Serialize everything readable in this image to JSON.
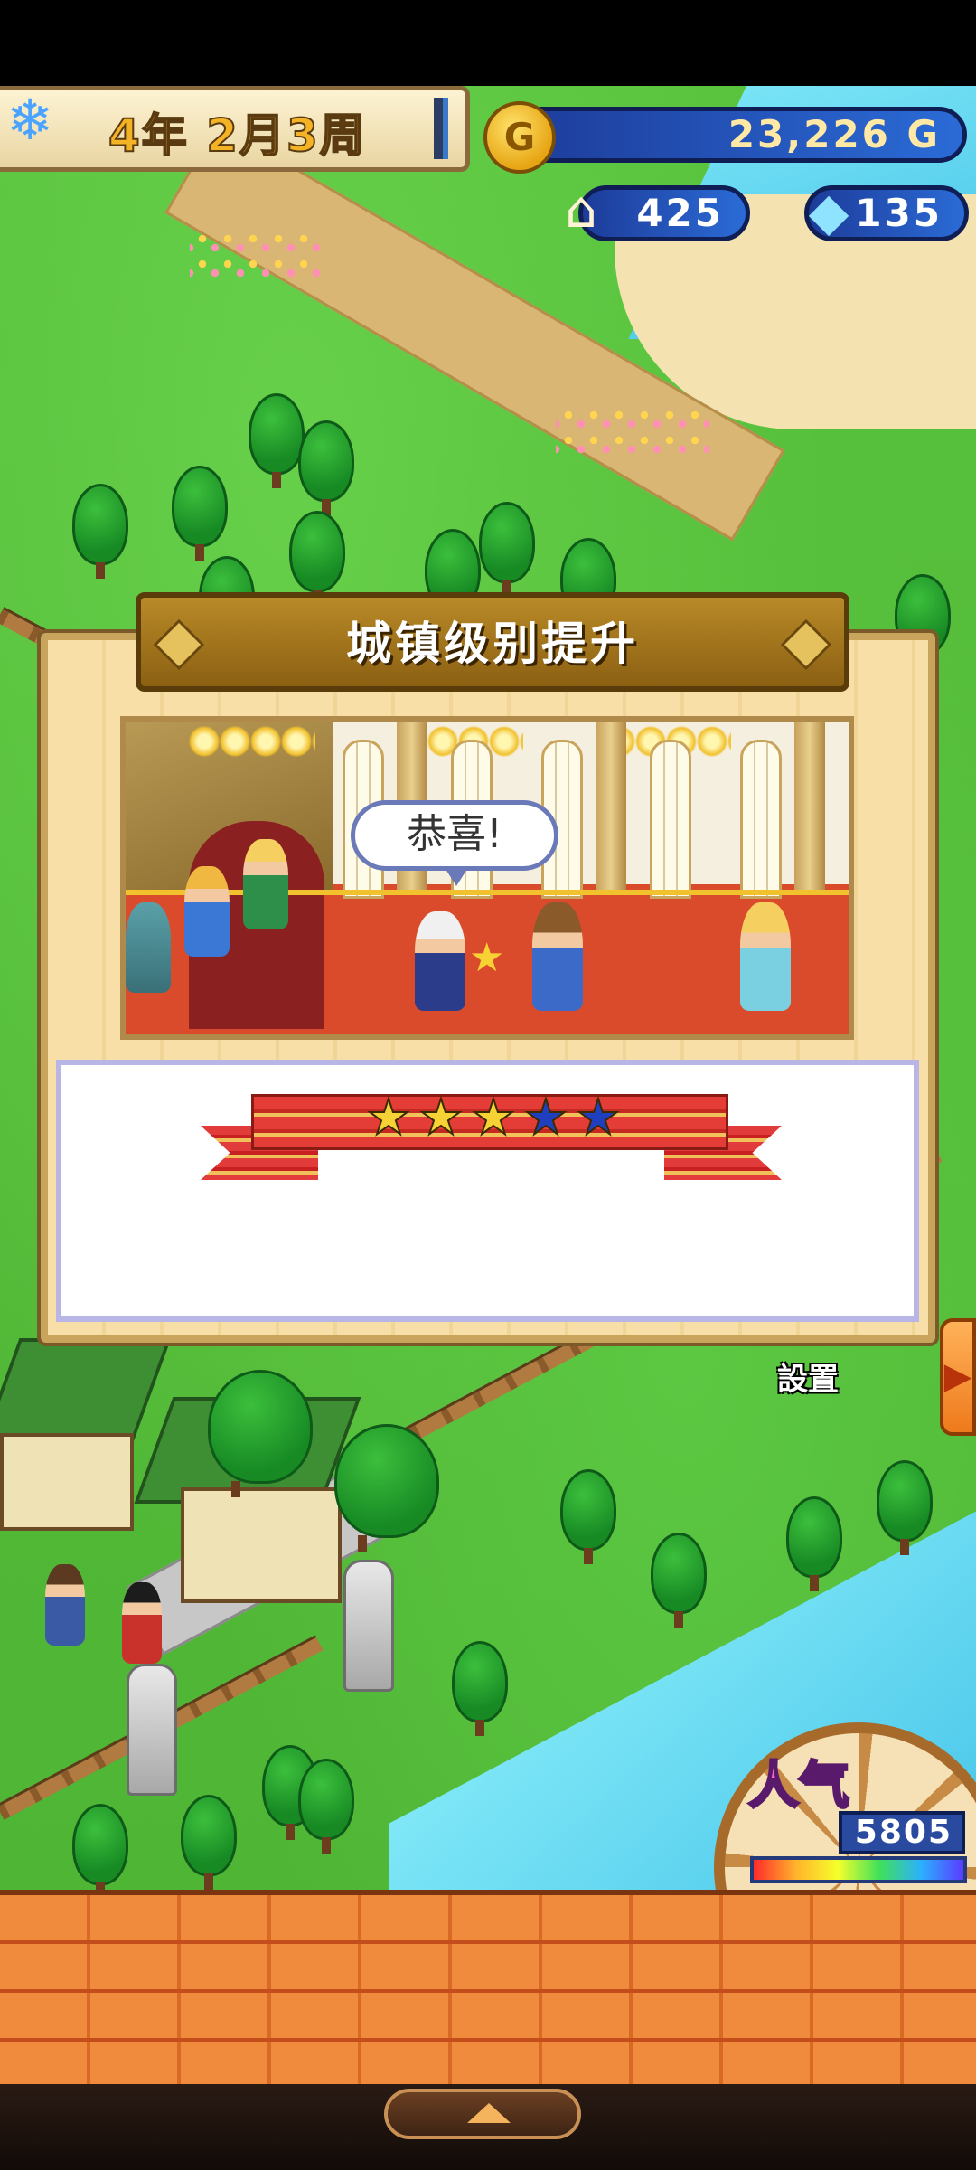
{
  "hud": {
    "date": "4年 2月3周",
    "gold": "23,226 G",
    "gold_icon": "G",
    "population": "425",
    "gems": "135"
  },
  "dialog": {
    "title": "城镇级别提升",
    "speech": "恭喜!",
    "rating_filled": 3,
    "rating_total": 5,
    "stars": [
      "★",
      "★",
      "★",
      "★",
      "★"
    ]
  },
  "side": {
    "settings_label": "設置",
    "arrow": "▶"
  },
  "popularity": {
    "label": "人气",
    "value": "5805"
  },
  "colors": {
    "star_gold": "#f7d234",
    "star_blue": "#1f3fbf",
    "gold_text": "#ffe9a5",
    "banner_brown": "#8b6012"
  },
  "icons": {
    "season": "snowflake-icon",
    "gold": "gold-coin-icon",
    "population": "house-icon",
    "gems": "crystal-icon",
    "settings": "settings-icon",
    "expand": "chevron-up-icon"
  }
}
